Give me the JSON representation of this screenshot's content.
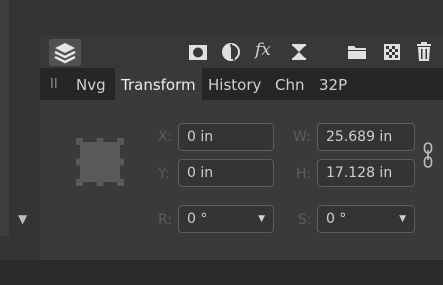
{
  "toolbar": {
    "icons": [
      "studio-stack-icon",
      "mask-icon",
      "adjustment-icon",
      "fx-icon",
      "hourglass-icon",
      "folder-icon",
      "checkerboard-icon",
      "trash-icon"
    ],
    "fx_label": "fx"
  },
  "tabs": [
    {
      "label": "Nvg",
      "active": false
    },
    {
      "label": "Transform",
      "active": true
    },
    {
      "label": "History",
      "active": false
    },
    {
      "label": "Chn",
      "active": false
    },
    {
      "label": "32P",
      "active": false
    }
  ],
  "grip_label": "II",
  "transform": {
    "x_label": "X:",
    "x_value": "0 in",
    "y_label": "Y:",
    "y_value": "0 in",
    "w_label": "W:",
    "w_value": "25.689 in",
    "h_label": "H:",
    "h_value": "17.128 in",
    "r_label": "R:",
    "r_value": "0 °",
    "s_label": "S:",
    "s_value": "0 °"
  },
  "colors": {
    "panel_bg": "#3a3a3a",
    "tabbar_bg": "#262626",
    "field_border": "#5d5d5d"
  }
}
